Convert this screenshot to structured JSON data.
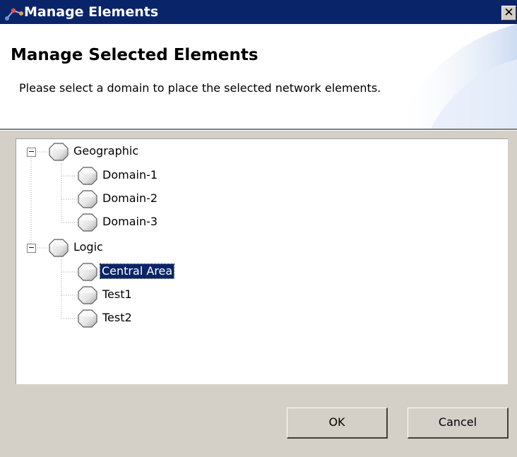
{
  "window": {
    "title": "Manage Elements",
    "close_symbol": "✕",
    "icon": "network-link-icon"
  },
  "header": {
    "title": "Manage Selected Elements",
    "description": "Please select a domain to place the selected network elements."
  },
  "tree": {
    "node_icon": "domain-hexagon-icon",
    "collapse_symbol": "−",
    "groups": [
      {
        "label": "Geographic",
        "expanded": true,
        "children": [
          {
            "label": "Domain-1"
          },
          {
            "label": "Domain-2"
          },
          {
            "label": "Domain-3"
          }
        ]
      },
      {
        "label": "Logic",
        "expanded": true,
        "children": [
          {
            "label": "Central Area",
            "selected": true
          },
          {
            "label": "Test1"
          },
          {
            "label": "Test2"
          }
        ]
      }
    ]
  },
  "buttons": {
    "ok_label": "OK",
    "cancel_label": "Cancel"
  },
  "colors": {
    "titlebar": "#0a246a",
    "selection": "#0a246a",
    "dialog_face": "#d4d0c8"
  }
}
